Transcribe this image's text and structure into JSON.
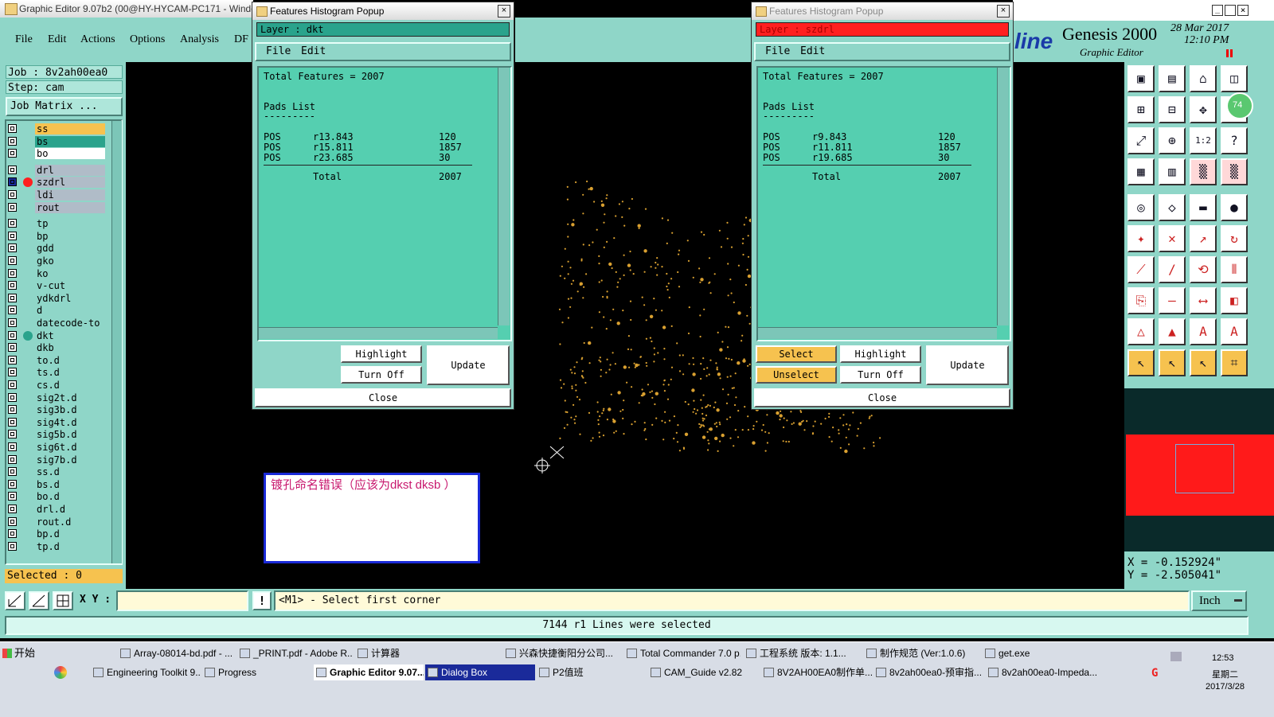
{
  "main_window": {
    "title": "Graphic Editor 9.07b2 (00@HY-HYCAM-PC171 - Window",
    "menu": [
      "File",
      "Edit",
      "Actions",
      "Options",
      "Analysis",
      "DF"
    ]
  },
  "brand": {
    "logo": "line",
    "product": "Genesis 2000",
    "subtitle": "Graphic Editor",
    "date": "28 Mar 2017",
    "time": "12:10 PM"
  },
  "job_panel": {
    "job": "Job  : 8v2ah00ea0",
    "step": "Step: cam",
    "matrix_button": "Job Matrix ...",
    "selected": "Selected : 0"
  },
  "layers": [
    {
      "name": "ss",
      "color": "#f6c24f"
    },
    {
      "name": "bs",
      "color": "#2aa38c"
    },
    {
      "name": "bo",
      "color": "#ffffff"
    },
    {
      "name": "drl",
      "color": "#b0bcc8"
    },
    {
      "name": "szdrl",
      "color": "#b0bcc8"
    },
    {
      "name": "ldi",
      "color": "#b0bcc8"
    },
    {
      "name": "rout",
      "color": "#b0bcc8"
    },
    {
      "name": "tp",
      "color": "#8fd6c8"
    },
    {
      "name": "bp",
      "color": "#8fd6c8"
    },
    {
      "name": "gdd",
      "color": "#8fd6c8"
    },
    {
      "name": "gko",
      "color": "#8fd6c8"
    },
    {
      "name": "ko",
      "color": "#8fd6c8"
    },
    {
      "name": "v-cut",
      "color": "#8fd6c8"
    },
    {
      "name": "ydkdrl",
      "color": "#8fd6c8"
    },
    {
      "name": "d",
      "color": "#8fd6c8"
    },
    {
      "name": "datecode-to",
      "color": "#8fd6c8"
    },
    {
      "name": "dkt",
      "color": "#8fd6c8"
    },
    {
      "name": "dkb",
      "color": "#8fd6c8"
    },
    {
      "name": "to.d",
      "color": "#8fd6c8"
    },
    {
      "name": "ts.d",
      "color": "#8fd6c8"
    },
    {
      "name": "cs.d",
      "color": "#8fd6c8"
    },
    {
      "name": "sig2t.d",
      "color": "#8fd6c8"
    },
    {
      "name": "sig3b.d",
      "color": "#8fd6c8"
    },
    {
      "name": "sig4t.d",
      "color": "#8fd6c8"
    },
    {
      "name": "sig5b.d",
      "color": "#8fd6c8"
    },
    {
      "name": "sig6t.d",
      "color": "#8fd6c8"
    },
    {
      "name": "sig7b.d",
      "color": "#8fd6c8"
    },
    {
      "name": "ss.d",
      "color": "#8fd6c8"
    },
    {
      "name": "bs.d",
      "color": "#8fd6c8"
    },
    {
      "name": "bo.d",
      "color": "#8fd6c8"
    },
    {
      "name": "drl.d",
      "color": "#8fd6c8"
    },
    {
      "name": "rout.d",
      "color": "#8fd6c8"
    },
    {
      "name": "bp.d",
      "color": "#8fd6c8"
    },
    {
      "name": "tp.d",
      "color": "#8fd6c8"
    }
  ],
  "popup1": {
    "title": "Features Histogram Popup",
    "layer_label": "Layer :  dkt",
    "layer_color": "#2aa38c",
    "menu": [
      "File",
      "Edit"
    ],
    "total": "Total Features = 2007",
    "list_title": "Pads List",
    "underline": "---------",
    "rows": [
      {
        "type": "POS",
        "sym": "r13.843",
        "count": "120"
      },
      {
        "type": "POS",
        "sym": "r15.811",
        "count": "1857"
      },
      {
        "type": "POS",
        "sym": "r23.685",
        "count": "30"
      }
    ],
    "total_label": "Total",
    "total_value": "2007",
    "buttons": {
      "highlight": "Highlight",
      "turn_off": "Turn Off",
      "update": "Update",
      "close": "Close"
    }
  },
  "popup2": {
    "title": "Features Histogram Popup",
    "layer_label": "Layer :  szdrl",
    "layer_color": "#ff2020",
    "menu": [
      "File",
      "Edit"
    ],
    "total": "Total Features = 2007",
    "list_title": "Pads List",
    "underline": "---------",
    "rows": [
      {
        "type": "POS",
        "sym": "r9.843",
        "count": "120"
      },
      {
        "type": "POS",
        "sym": "r11.811",
        "count": "1857"
      },
      {
        "type": "POS",
        "sym": "r19.685",
        "count": "30"
      }
    ],
    "total_label": "Total",
    "total_value": "2007",
    "buttons": {
      "select": "Select",
      "unselect": "Unselect",
      "highlight": "Highlight",
      "turn_off": "Turn Off",
      "update": "Update",
      "close": "Close"
    }
  },
  "note": {
    "text": "镀孔命名错误（应该为dkst  dksb ）",
    "color": "#c8186e"
  },
  "coords": {
    "x": "X = -0.152924\"",
    "y": "Y = -2.505041\""
  },
  "status": {
    "xy_label": "X Y :",
    "xy_value": "",
    "prompt": "<M1> - Select first corner",
    "unit": "Inch",
    "message": "7144 r1 Lines were selected",
    "badge": "74"
  },
  "taskbar": {
    "start": "开始",
    "row1": [
      "Array-08014-bd.pdf - ...",
      "_PRINT.pdf - Adobe R...",
      "计算器",
      "兴森快捷衡阳分公司...",
      "Total Commander 7.0 p...",
      "工程系统  版本: 1.1...",
      "制作规范 (Ver:1.0.6)",
      "get.exe"
    ],
    "row2": [
      "Engineering Toolkit 9....",
      "Progress",
      "Graphic Editor 9.07...",
      "Dialog Box",
      "P2值班",
      "CAM_Guide v2.82",
      "8V2AH00EA0制作单...",
      "8v2ah00ea0-预审指...",
      "8v2ah00ea0-Impeda..."
    ],
    "clock": "12:53",
    "weekday": "星期二",
    "date": "2017/3/28"
  },
  "icons": [
    "open-icon",
    "save-icon",
    "home-icon",
    "window-icon",
    "zoom-in-icon",
    "zoom-out-icon",
    "pan-icon",
    "help-icon",
    "fit-icon",
    "center-icon",
    "ratio-icon",
    "query-icon",
    "grid-icon",
    "snap-icon",
    "layer-a-icon",
    "layer-b-icon",
    "rect-select-icon",
    "polygon-icon",
    "ruler-icon",
    "dot-icon",
    "connect-icon",
    "cross-icon",
    "move-icon",
    "rotate-icon",
    "line-icon",
    "slash-icon",
    "arc-icon",
    "mirror-icon",
    "copy-icon",
    "minus-icon",
    "measure-icon",
    "stack-icon",
    "triangle-a-icon",
    "triangle-b-icon",
    "text-a-icon",
    "text-b-icon",
    "pointer-icon",
    "pointer-b-icon",
    "pointer-c-icon",
    "chart-icon"
  ]
}
